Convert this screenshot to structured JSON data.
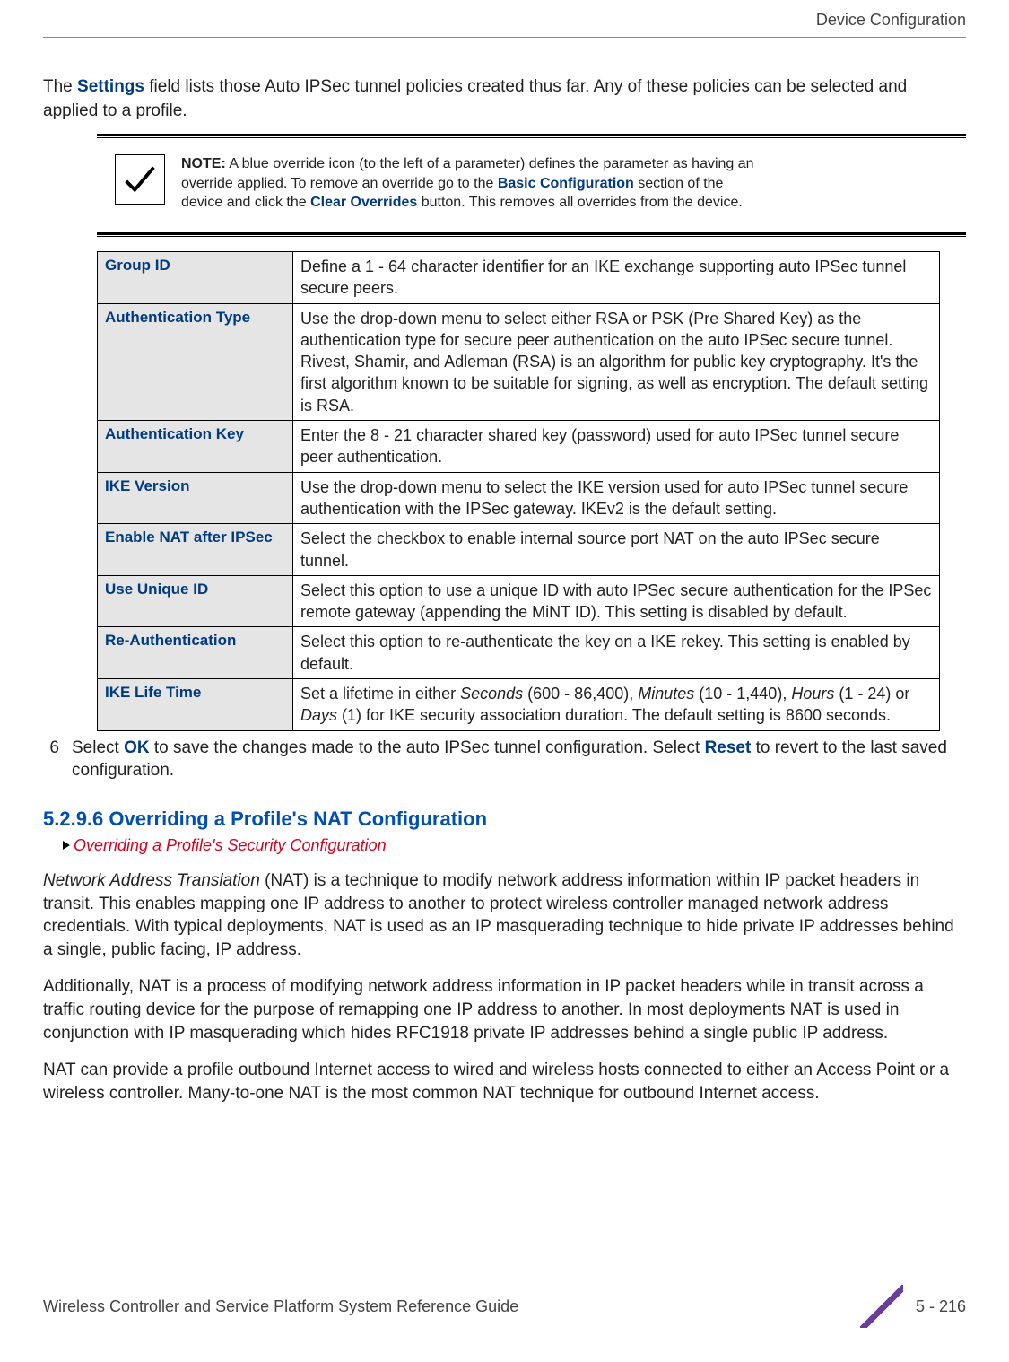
{
  "header": {
    "running_title": "Device Configuration"
  },
  "intro": {
    "prefix": "The ",
    "kw": "Settings",
    "suffix": " field lists those Auto IPSec tunnel policies created thus far. Any of these policies can be selected and applied to a profile."
  },
  "note": {
    "label": "NOTE:",
    "text1": " A blue override icon (to the left of a parameter) defines the parameter as having an override applied. To remove an override go to the ",
    "kw1": "Basic Configuration",
    "text2": " section of the device and click the ",
    "kw2": "Clear Overrides",
    "text3": " button. This removes all overrides from the device."
  },
  "params": [
    {
      "label": "Group ID",
      "desc": "Define a 1 - 64 character identifier for an IKE exchange supporting auto IPSec tunnel secure peers."
    },
    {
      "label": "Authentication Type",
      "desc": "Use the drop-down menu to select either RSA or PSK (Pre Shared Key) as the authentication type for secure peer authentication on the auto IPSec secure tunnel. Rivest, Shamir, and Adleman (RSA) is an algorithm for public key cryptography. It's the first algorithm known to be suitable for signing, as well as encryption. The default setting is RSA."
    },
    {
      "label": "Authentication Key",
      "desc": "Enter the 8 - 21 character shared key (password) used for auto IPSec tunnel secure peer authentication."
    },
    {
      "label": "IKE Version",
      "desc": "Use the drop-down menu to select the IKE version used for auto IPSec tunnel secure authentication with the IPSec gateway. IKEv2 is the default setting."
    },
    {
      "label": "Enable NAT after IPSec",
      "desc": "Select the checkbox to enable internal source port NAT on the auto IPSec secure tunnel."
    },
    {
      "label": "Use Unique ID",
      "desc": "Select this option to use a unique ID with auto IPSec secure authentication for the IPSec remote gateway (appending the MiNT ID). This setting is disabled by default."
    },
    {
      "label": "Re-Authentication",
      "desc": "Select this option to re-authenticate the key on a IKE rekey. This setting is enabled by default."
    },
    {
      "label": "IKE Life Time",
      "desc_html": "Set a lifetime in either <span class='it'>Seconds</span> (600 - 86,400), <span class='it'>Minutes</span> (10 - 1,440), <span class='it'>Hours</span> (1 - 24) or <span class='it'>Days</span> (1) for IKE security association duration. The default setting is 8600 seconds."
    }
  ],
  "step6": {
    "num": "6",
    "p1": "Select ",
    "kw1": "OK",
    "p2": " to save the changes made to the auto IPSec tunnel configuration. Select ",
    "kw2": "Reset",
    "p3": " to revert to the last saved configuration."
  },
  "section": {
    "heading": "5.2.9.6 Overriding a Profile's NAT Configuration",
    "crumb": "Overriding a Profile's Security Configuration"
  },
  "body": {
    "p1_a": "Network Address Translation",
    "p1_b": " (NAT) is a technique to modify network address information within IP packet headers in transit. This enables mapping one IP address to another to protect wireless controller managed network address credentials. With typical deployments, NAT is used as an IP masquerading technique to hide private IP addresses behind a single, public facing, IP address.",
    "p2": "Additionally, NAT is a process of modifying network address information in IP packet headers while in transit across a traffic routing device for the purpose of remapping one IP address to another. In most deployments NAT is used in conjunction with IP masquerading which hides RFC1918 private IP addresses behind a single public IP address.",
    "p3": "NAT can provide a profile outbound Internet access to wired and wireless hosts connected to either an Access Point or a wireless controller. Many-to-one NAT is the most common NAT technique for outbound Internet access."
  },
  "footer": {
    "title": "Wireless Controller and Service Platform System Reference Guide",
    "page": "5 - 216"
  }
}
